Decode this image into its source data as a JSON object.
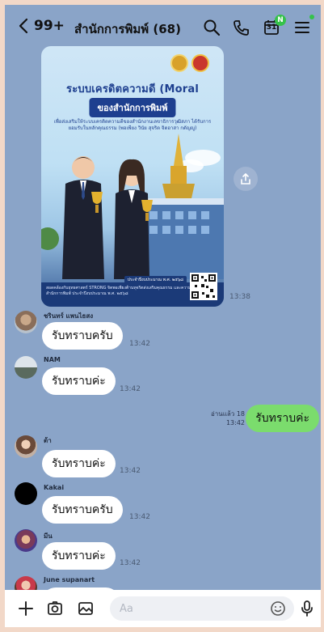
{
  "header": {
    "back_count": "99+",
    "title": "สำนักการพิมพ์ (68)",
    "calendar_day": "31",
    "calendar_badge": "N"
  },
  "poster": {
    "title": "ระบบเครดิตความดี (Moral Credit)",
    "subtitle": "ของสำนักการพิมพ์",
    "description": "เพื่อส่งเสริมให้ระบบเครดิตความดีของสำนักงานเลขาธิการวุฒิสภา ได้รับการยอมรับในหลักคุณธรรม (พอเพียง วินัย สุจริต จิตอาสา กตัญญู)",
    "badge": "ประจำปีงบประมาณ พ.ศ. ๒๕๖๘",
    "footer": "สอดคล้องกับยุทธศาสตร์ STRONG จิตพอเพียงต้านทุจริตส่งเสริมคุณธรรม และความโปร่งใสของสำนักการพิมพ์ ประจำปีงบประมาณ พ.ศ. ๒๕๖๘",
    "time": "13:38"
  },
  "messages": [
    {
      "sender": "ชรินทร์ แพนไธสง",
      "text": "รับทราบครับ",
      "time": "13:42"
    },
    {
      "sender": "NAM",
      "text": "รับทราบค่ะ",
      "time": "13:42"
    },
    {
      "sender": "",
      "text": "รับทราบค่ะ",
      "time": "13:42",
      "mine": true,
      "read": "อ่านแล้ว 18"
    },
    {
      "sender": "ต้า",
      "text": "รับทราบค่ะ",
      "time": "13:42"
    },
    {
      "sender": "Kakai",
      "text": "รับทราบครับ",
      "time": "13:42"
    },
    {
      "sender": "มีน",
      "text": "รับทราบค่ะ",
      "time": "13:42"
    },
    {
      "sender": "June supanart",
      "text": "",
      "time": ""
    }
  ],
  "input": {
    "placeholder": "Aa"
  },
  "colors": {
    "chat_background": "#8aa4c8",
    "my_bubble": "#7bdc6d",
    "other_bubble": "#ffffff",
    "accent_green": "#35c24a"
  },
  "icons": {
    "back": "chevron-left-icon",
    "search": "search-icon",
    "call": "phone-icon",
    "calendar": "calendar-icon",
    "menu": "menu-icon",
    "share": "share-icon",
    "add": "plus-icon",
    "camera": "camera-icon",
    "image": "image-icon",
    "emoji": "emoji-icon",
    "mic": "microphone-icon"
  }
}
